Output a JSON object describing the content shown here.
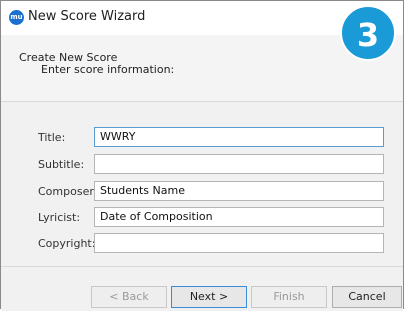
{
  "window": {
    "title": "New Score Wizard",
    "app_icon_text": "mu",
    "step_badge": "3"
  },
  "header": {
    "title": "Create New Score",
    "subtitle": "Enter score information:"
  },
  "form": {
    "fields": [
      {
        "label": "Title:",
        "value": "WWRY"
      },
      {
        "label": "Subtitle:",
        "value": ""
      },
      {
        "label": "Composer:",
        "value": "Students Name"
      },
      {
        "label": "Lyricist:",
        "value": "Date of Composition"
      },
      {
        "label": "Copyright:",
        "value": ""
      }
    ]
  },
  "buttons": {
    "back": "< Back",
    "next": "Next >",
    "finish": "Finish",
    "cancel": "Cancel"
  },
  "colors": {
    "badge": "#1a9ad6",
    "app_icon": "#1b6fd1",
    "focus_border": "#5b9bd5"
  }
}
